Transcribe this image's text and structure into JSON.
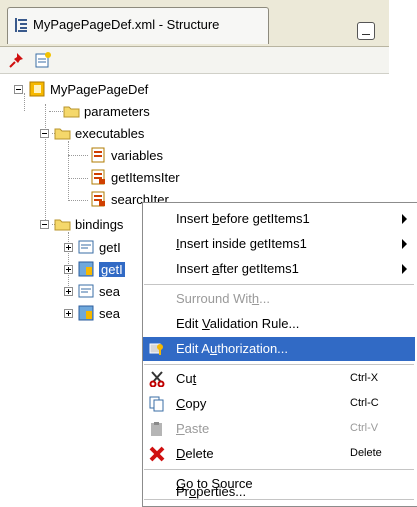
{
  "panel": {
    "tab_title": "MyPagePageDef.xml - Structure"
  },
  "toolbar": {
    "buttons": [
      "pin-icon",
      "new-item-icon"
    ]
  },
  "tree": {
    "root": "MyPagePageDef",
    "parameters": "parameters",
    "executables": "executables",
    "variables": "variables",
    "getItemsIter": "getItemsIter",
    "searchIter": "searchIter",
    "bindings": "bindings",
    "binding_1": "getI",
    "binding_2": "getI",
    "binding_3": "sea",
    "binding_4": "sea"
  },
  "context_menu": {
    "insert_before": {
      "pre": "Insert ",
      "mn": "b",
      "post": "efore getItems1"
    },
    "insert_inside": {
      "pre": "",
      "mn": "I",
      "post": "nsert inside getItems1"
    },
    "insert_after": {
      "pre": "Insert ",
      "mn": "a",
      "post": "fter getItems1"
    },
    "surround": {
      "pre": "Surround Wit",
      "mn": "h",
      "post": "..."
    },
    "edit_validation": {
      "pre": "Edit ",
      "mn": "V",
      "post": "alidation Rule..."
    },
    "edit_authorization": {
      "pre": "Edit A",
      "mn": "u",
      "post": "thorization..."
    },
    "cut": {
      "pre": "Cu",
      "mn": "t",
      "post": "",
      "accel": "Ctrl-X"
    },
    "copy": {
      "pre": "",
      "mn": "C",
      "post": "opy",
      "accel": "Ctrl-C"
    },
    "paste": {
      "pre": "",
      "mn": "P",
      "post": "aste",
      "accel": "Ctrl-V"
    },
    "delete": {
      "pre": "",
      "mn": "D",
      "post": "elete",
      "accel": "Delete"
    },
    "go_to_source": {
      "pre": "",
      "mn": "G",
      "post": "o to Source"
    },
    "properties": {
      "pre": "Pr",
      "mn": "o",
      "post": "perties..."
    }
  },
  "colors": {
    "selection": "#316ac5",
    "disabled_text": "#9a9a9a",
    "chrome": "#ece9d8"
  }
}
